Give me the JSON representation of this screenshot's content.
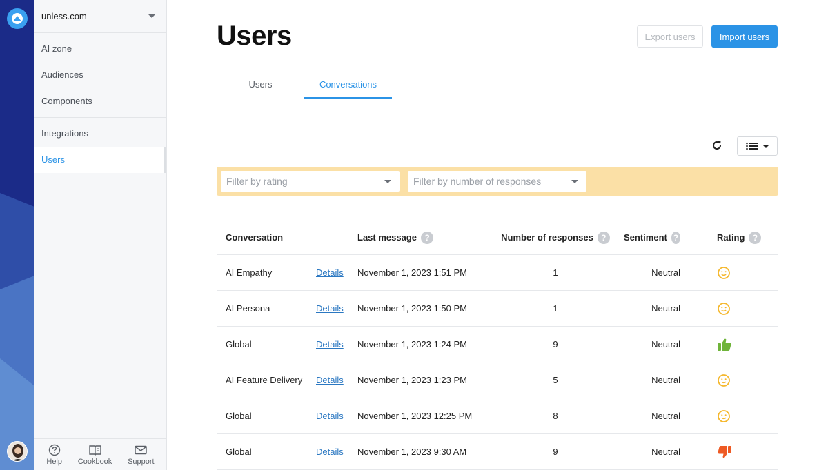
{
  "colors": {
    "accent": "#2b93e6",
    "filter_bar": "#fbe0a6",
    "rating_neutral": "#f5b82e",
    "rating_up": "#6fb43a",
    "rating_down": "#ee5a24"
  },
  "sidebar": {
    "workspace": "unless.com",
    "groups": [
      [
        {
          "label": "AI zone"
        },
        {
          "label": "Audiences"
        },
        {
          "label": "Components"
        }
      ],
      [
        {
          "label": "Integrations"
        },
        {
          "label": "Users",
          "active": true
        }
      ]
    ],
    "footer": [
      {
        "label": "Help",
        "icon": "help-icon"
      },
      {
        "label": "Cookbook",
        "icon": "cookbook-icon"
      },
      {
        "label": "Support",
        "icon": "mail-icon"
      }
    ]
  },
  "header": {
    "title": "Users",
    "export_label": "Export users",
    "import_label": "Import users"
  },
  "tabs": [
    {
      "label": "Users",
      "active": false
    },
    {
      "label": "Conversations",
      "active": true
    }
  ],
  "filters": {
    "rating_placeholder": "Filter by rating",
    "responses_placeholder": "Filter by number of responses"
  },
  "table": {
    "columns": {
      "conversation": "Conversation",
      "last_message": "Last message",
      "responses": "Number of responses",
      "sentiment": "Sentiment",
      "rating": "Rating"
    },
    "details_label": "Details",
    "rows": [
      {
        "conversation": "AI Empathy",
        "last_message": "November 1, 2023 1:51 PM",
        "responses": "1",
        "sentiment": "Neutral",
        "rating": "neutral"
      },
      {
        "conversation": "AI Persona",
        "last_message": "November 1, 2023 1:50 PM",
        "responses": "1",
        "sentiment": "Neutral",
        "rating": "neutral"
      },
      {
        "conversation": "Global",
        "last_message": "November 1, 2023 1:24 PM",
        "responses": "9",
        "sentiment": "Neutral",
        "rating": "thumbs-up"
      },
      {
        "conversation": "AI Feature Delivery",
        "last_message": "November 1, 2023 1:23 PM",
        "responses": "5",
        "sentiment": "Neutral",
        "rating": "neutral"
      },
      {
        "conversation": "Global",
        "last_message": "November 1, 2023 12:25 PM",
        "responses": "8",
        "sentiment": "Neutral",
        "rating": "neutral"
      },
      {
        "conversation": "Global",
        "last_message": "November 1, 2023 9:30 AM",
        "responses": "9",
        "sentiment": "Neutral",
        "rating": "thumbs-down"
      }
    ]
  }
}
